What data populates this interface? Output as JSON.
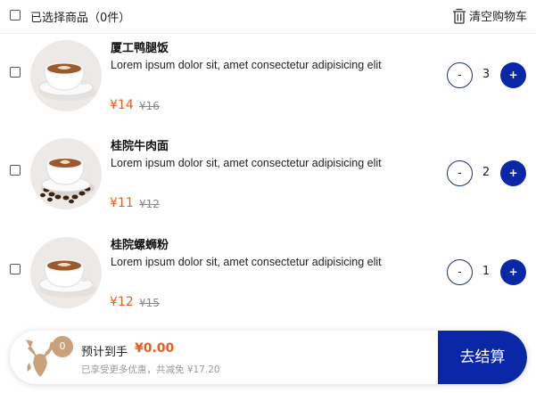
{
  "header": {
    "select_all_label": "已选择商品（0件）",
    "clear_cart_label": "清空购物车"
  },
  "items": [
    {
      "name": "厦工鸭腿饭",
      "description": "Lorem ipsum dolor sit, amet consectetur adipisicing elit",
      "price": "¥14",
      "original_price": "¥16",
      "quantity": "3",
      "minus": "-",
      "plus": "+",
      "image": "coffee-cup-icon"
    },
    {
      "name": "桂院牛肉面",
      "description": "Lorem ipsum dolor sit, amet consectetur adipisicing elit",
      "price": "¥11",
      "original_price": "¥12",
      "quantity": "2",
      "minus": "-",
      "plus": "+",
      "image": "coffee-cup-with-beans-icon"
    },
    {
      "name": "桂院螺蛳粉",
      "description": "Lorem ipsum dolor sit, amet consectetur adipisicing elit",
      "price": "¥12",
      "original_price": "¥15",
      "quantity": "1",
      "minus": "-",
      "plus": "+",
      "image": "coffee-cup-icon"
    }
  ],
  "bottom_bar": {
    "badge_count": "0",
    "expected_label": "预计到手",
    "total": "¥0.00",
    "discount_text": "已享受更多优惠，共减免 ¥17.20",
    "checkout_label": "去结算",
    "logo": "deer-logo-icon"
  },
  "colors": {
    "accent": "#0a27a8",
    "price": "#ec5b1e",
    "badge": "#c9a27c"
  }
}
